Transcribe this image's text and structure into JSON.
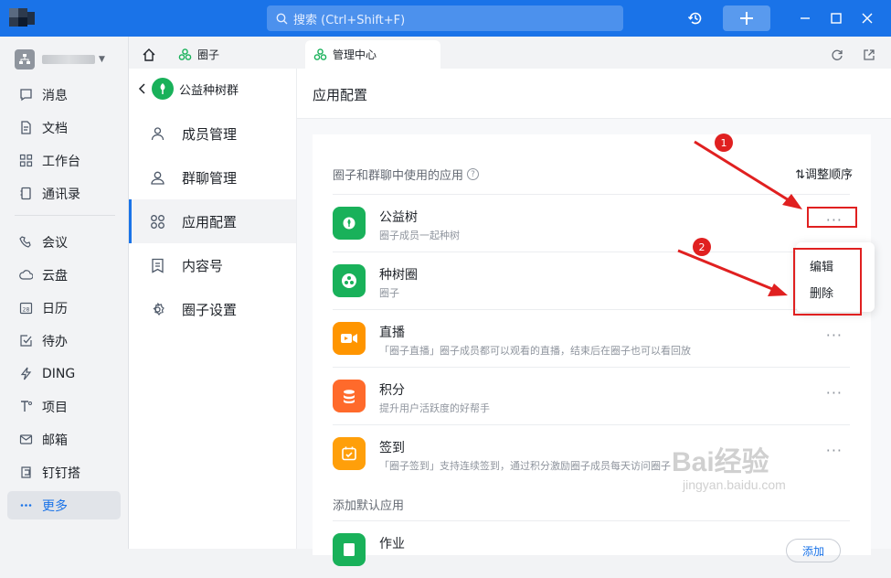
{
  "titlebar": {
    "search_placeholder": "搜索 (Ctrl+Shift+F)",
    "accent": "#1a73e8"
  },
  "sidebar": {
    "items": [
      {
        "label": "消息",
        "icon": "message-icon"
      },
      {
        "label": "文档",
        "icon": "document-icon"
      },
      {
        "label": "工作台",
        "icon": "grid-icon"
      },
      {
        "label": "通讯录",
        "icon": "contacts-icon"
      },
      {
        "label": "会议",
        "icon": "meeting-icon"
      },
      {
        "label": "云盘",
        "icon": "cloud-icon"
      },
      {
        "label": "日历",
        "icon": "calendar-icon"
      },
      {
        "label": "待办",
        "icon": "todo-icon"
      },
      {
        "label": "DING",
        "icon": "lightning-icon"
      },
      {
        "label": "项目",
        "icon": "project-icon"
      },
      {
        "label": "邮箱",
        "icon": "mail-icon"
      },
      {
        "label": "钉钉搭",
        "icon": "builder-icon"
      },
      {
        "label": "更多",
        "icon": "more-icon"
      }
    ]
  },
  "tabs": [
    {
      "label": "圈子",
      "icon": "circle-group-icon"
    },
    {
      "label": "管理中心",
      "icon": "circle-group-icon"
    }
  ],
  "panel": {
    "group_name": "公益种树群",
    "menu": [
      {
        "label": "成员管理",
        "icon": "member-icon"
      },
      {
        "label": "群聊管理",
        "icon": "group-chat-icon"
      },
      {
        "label": "应用配置",
        "icon": "apps-icon"
      },
      {
        "label": "内容号",
        "icon": "content-icon"
      },
      {
        "label": "圈子设置",
        "icon": "settings-icon"
      }
    ]
  },
  "main": {
    "title": "应用配置",
    "section_title": "圈子和群聊中使用的应用",
    "help": "?",
    "reorder": "⇅调整顺序",
    "apps": [
      {
        "name": "公益树",
        "desc": "圈子成员一起种树",
        "color": "#19b15a",
        "icon": "tree-leaf-icon"
      },
      {
        "name": "种树圈",
        "desc": "圈子",
        "color": "#19b15a",
        "icon": "tree-circle-icon"
      },
      {
        "name": "直播",
        "desc": "「圈子直播」圈子成员都可以观看的直播，结束后在圈子也可以看回放",
        "color": "#ff9500",
        "icon": "live-video-icon"
      },
      {
        "name": "积分",
        "desc": "提升用户活跃度的好帮手",
        "color": "#ff6a2b",
        "icon": "points-icon"
      },
      {
        "name": "签到",
        "desc": "「圈子签到」支持连续签到，通过积分激励圈子成员每天访问圈子",
        "color": "#ff9f0a",
        "icon": "checkin-icon"
      }
    ],
    "more": "···",
    "default_section": "添加默认应用",
    "default_app": {
      "name": "作业",
      "color": "#19b15a",
      "button": "添加"
    }
  },
  "popup": {
    "edit": "编辑",
    "delete": "删除"
  },
  "annotations": {
    "one": "1",
    "two": "2"
  },
  "watermark": {
    "brand": "Bai经验",
    "url": "jingyan.baidu.com"
  }
}
